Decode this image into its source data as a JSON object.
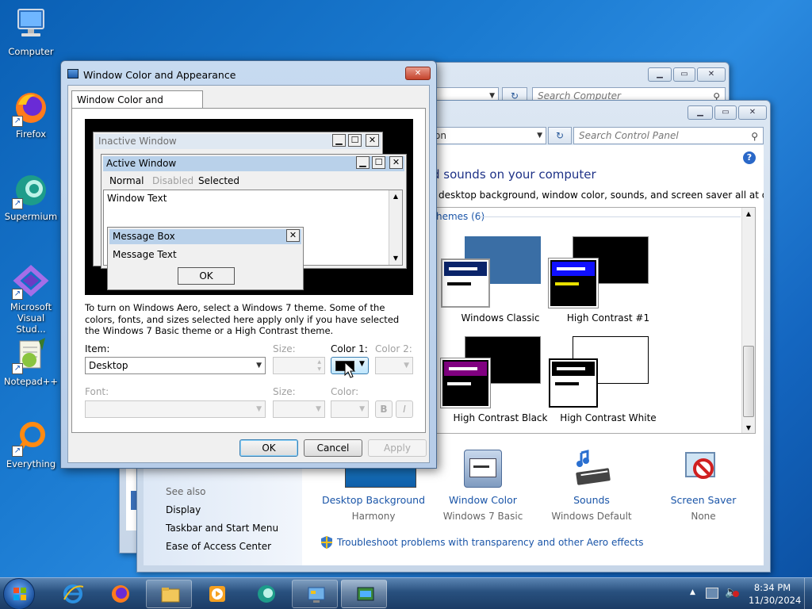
{
  "desktop": {
    "icons": [
      {
        "label": "Computer"
      },
      {
        "label": "Firefox"
      },
      {
        "label": "Supermium"
      },
      {
        "label": "Microsoft Visual Stud..."
      },
      {
        "label": "Notepad++"
      },
      {
        "label": "Everything"
      }
    ]
  },
  "back_window": {
    "search_placeholder": "Search Computer"
  },
  "control_panel": {
    "address_fragment": "on",
    "search_placeholder": "Search Control Panel",
    "heading": "d sounds on your computer",
    "subheading": "desktop background, window color, sounds, and screen saver all at once.",
    "themes_group": "hemes (6)",
    "themes": [
      {
        "name": "Windows Classic"
      },
      {
        "name": "High Contrast #1"
      },
      {
        "name": "High Contrast Black"
      },
      {
        "name": "High Contrast White"
      }
    ],
    "see_also": {
      "title": "See also",
      "links": [
        "Display",
        "Taskbar and Start Menu",
        "Ease of Access Center"
      ]
    },
    "bottom_items": [
      {
        "label": "Desktop Background",
        "sub": "Harmony"
      },
      {
        "label": "Window Color",
        "sub": "Windows 7 Basic"
      },
      {
        "label": "Sounds",
        "sub": "Windows Default"
      },
      {
        "label": "Screen Saver",
        "sub": "None"
      }
    ],
    "troubleshoot_link": "Troubleshoot problems with transparency and other Aero effects",
    "help": "?"
  },
  "dialog": {
    "title": "Window Color and Appearance",
    "tab": "Window Color and Appearance",
    "preview": {
      "inactive_window": "Inactive Window",
      "active_window": "Active Window",
      "menu_normal": "Normal",
      "menu_disabled": "Disabled",
      "menu_selected": "Selected",
      "window_text": "Window Text",
      "message_box": "Message Box",
      "message_text": "Message Text",
      "ok": "OK"
    },
    "info_text": "To turn on Windows Aero, select a Windows 7 theme.  Some of the colors, fonts, and sizes selected here apply only if you have selected the Windows 7 Basic theme or a High Contrast theme.",
    "item_label": "Item:",
    "item_value": "Desktop",
    "size_label": "Size:",
    "color1_label": "Color 1:",
    "color2_label": "Color 2:",
    "font_label": "Font:",
    "size2_label": "Size:",
    "color_label": "Color:",
    "bold_btn": "B",
    "italic_btn": "I",
    "ok": "OK",
    "cancel": "Cancel",
    "apply": "Apply",
    "color1_swatch": "#000000"
  },
  "taskbar": {
    "time": "8:34 PM",
    "date": "11/30/2024"
  },
  "colors": {
    "accent": "#1a55a8",
    "caption_active": "#b9d1ea",
    "caption_inactive": "#dfe8f2"
  }
}
